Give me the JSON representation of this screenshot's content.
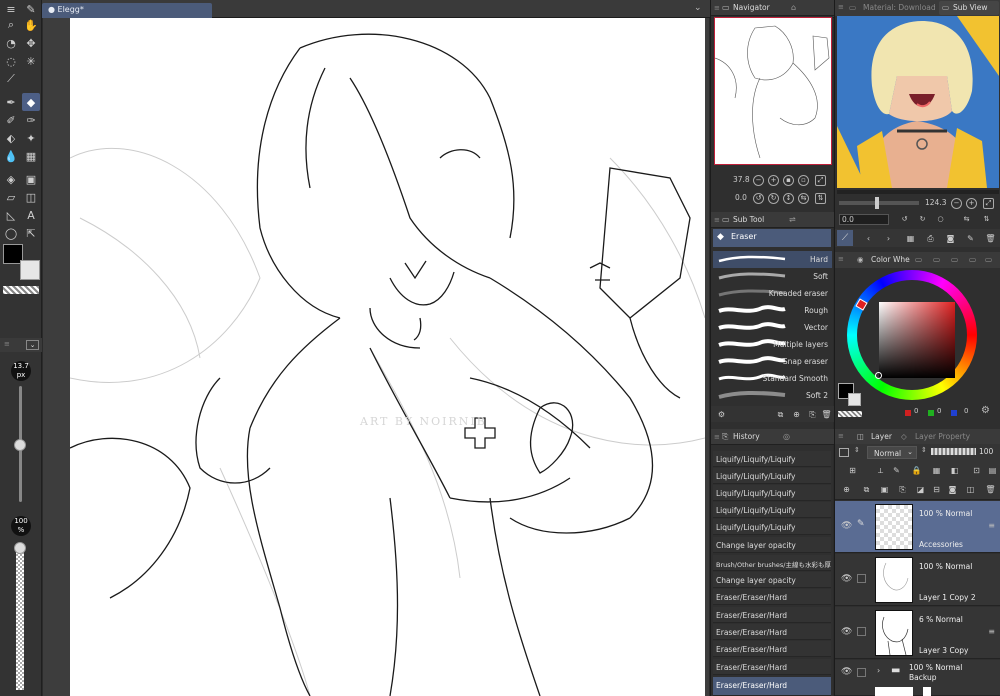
{
  "document": {
    "tab_title": "Elegg*"
  },
  "canvas": {
    "watermark": "ART BY NOIRNIB"
  },
  "brush_size": {
    "value": "13.7",
    "unit": "px",
    "level": 0.5
  },
  "brush_opacity": {
    "value": "100",
    "unit": "%"
  },
  "navigator": {
    "tab": "Navigator",
    "zoom": "37.8",
    "rotation": "0.0"
  },
  "subview": {
    "tab_material": "Material: Download",
    "tab_subview": "Sub View",
    "zoom": "124.3",
    "rotation": "0.0"
  },
  "subtool": {
    "tab": "Sub Tool",
    "group": "Eraser",
    "brushes": [
      {
        "name": "Hard",
        "selected": true
      },
      {
        "name": "Soft",
        "selected": false
      },
      {
        "name": "Kneaded eraser",
        "selected": false
      },
      {
        "name": "Rough",
        "selected": false
      },
      {
        "name": "Vector",
        "selected": false
      },
      {
        "name": "Multiple layers",
        "selected": false
      },
      {
        "name": "Snap eraser",
        "selected": false
      },
      {
        "name": "Standard Smooth",
        "selected": false
      },
      {
        "name": "Soft 2",
        "selected": false
      }
    ]
  },
  "history": {
    "tab": "History",
    "items": [
      {
        "label": "Liquify/Liquify/Liquify",
        "selected": false
      },
      {
        "label": "Liquify/Liquify/Liquify",
        "selected": false
      },
      {
        "label": "Liquify/Liquify/Liquify",
        "selected": false
      },
      {
        "label": "Liquify/Liquify/Liquify",
        "selected": false
      },
      {
        "label": "Liquify/Liquify/Liquify",
        "selected": false
      },
      {
        "label": "Change layer opacity",
        "selected": false
      },
      {
        "label": "Brush/Other brushes/主線も水彩も厚塗り",
        "selected": false
      },
      {
        "label": "Change layer opacity",
        "selected": false
      },
      {
        "label": "Eraser/Eraser/Hard",
        "selected": false
      },
      {
        "label": "Eraser/Eraser/Hard",
        "selected": false
      },
      {
        "label": "Eraser/Eraser/Hard",
        "selected": false
      },
      {
        "label": "Eraser/Eraser/Hard",
        "selected": false
      },
      {
        "label": "Eraser/Eraser/Hard",
        "selected": false
      },
      {
        "label": "Eraser/Eraser/Hard",
        "selected": true
      }
    ]
  },
  "color_wheel": {
    "tab": "Color Whe",
    "values": [
      "0",
      "0",
      "0"
    ]
  },
  "layers": {
    "tab_layer": "Layer",
    "tab_property": "Layer Property",
    "blend_mode": "Normal",
    "opacity": "100",
    "items": [
      {
        "opacity_mode": "100 % Normal",
        "name": "Accessories",
        "selected": true
      },
      {
        "opacity_mode": "100 % Normal",
        "name": "Layer 1 Copy 2",
        "selected": false
      },
      {
        "opacity_mode": "6 % Normal",
        "name": "Layer 3 Copy",
        "selected": false
      },
      {
        "opacity_mode": "100 % Normal",
        "name": "Backup",
        "selected": false
      }
    ]
  },
  "colors": {
    "accent": "#4b5b7a",
    "nav_border": "#c0203a"
  }
}
